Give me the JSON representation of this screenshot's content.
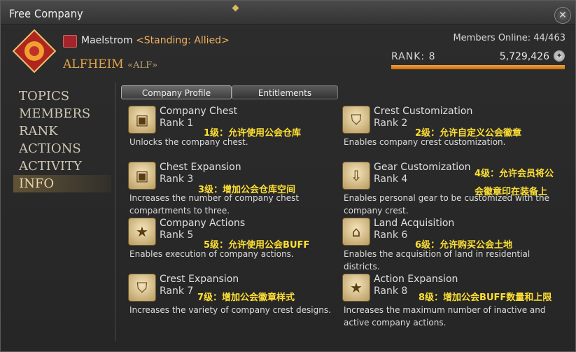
{
  "window": {
    "title": "Free Company",
    "close_glyph": "✕"
  },
  "header": {
    "grand_company": "Maelstrom",
    "standing": "<Standing: Allied>",
    "fc_name": "ALFHEIM",
    "fc_tag": "«ALF»",
    "members_online": "Members Online: 44/463",
    "rank_label": "RANK:",
    "rank_value": "8",
    "company_points": "5,729,426",
    "rank_progress": 1.0,
    "icons": {
      "crest": "fc-crest-icon",
      "gc": "maelstrom-icon",
      "points": "company-credits-icon"
    }
  },
  "sidebar": {
    "items": [
      {
        "label": "TOPICS"
      },
      {
        "label": "MEMBERS"
      },
      {
        "label": "RANK"
      },
      {
        "label": "ACTIONS"
      },
      {
        "label": "ACTIVITY"
      },
      {
        "label": "INFO",
        "active": true
      }
    ]
  },
  "tabs": [
    {
      "label": "Company Profile",
      "active": true
    },
    {
      "label": "Entitlements"
    }
  ],
  "entries": [
    {
      "name": "Company Chest",
      "rank": "Rank 1",
      "desc": "Unlocks the company chest.",
      "note": "1级：允许使用公会仓库",
      "icon": "chest-icon"
    },
    {
      "name": "Crest Customization",
      "rank": "Rank 2",
      "desc": "Enables company crest customization.",
      "note": "2级：允许自定义公会徽章",
      "icon": "shield-icon"
    },
    {
      "name": "Chest Expansion",
      "rank": "Rank 3",
      "desc": "Increases the number of company chest compartments to three.",
      "note": "3级：增加公会仓库空间",
      "icon": "chest-plus-icon"
    },
    {
      "name": "Gear Customization",
      "rank": "Rank 4",
      "desc": "Enables personal gear to be customized with the company crest.",
      "note": "4级：允许会员将公",
      "note2": "会徽章印在装备上",
      "icon": "gear-crest-icon"
    },
    {
      "name": "Company Actions",
      "rank": "Rank 5",
      "desc": "Enables execution of company actions.",
      "note": "5级：允许使用公会BUFF",
      "icon": "star-icon"
    },
    {
      "name": "Land Acquisition",
      "rank": "Rank 6",
      "desc": "Enables the acquisition of land in residential districts.",
      "note": "6级：允许购买公会土地",
      "icon": "house-icon"
    },
    {
      "name": "Crest Expansion",
      "rank": "Rank 7",
      "desc": "Increases the variety of company crest designs.",
      "note": "7级：增加公会徽章样式",
      "icon": "shield-plus-icon"
    },
    {
      "name": "Action Expansion",
      "rank": "Rank 8",
      "desc": "Increases the maximum number of inactive and active company actions.",
      "note": "8级：增加公会BUFF数量和上限",
      "icon": "star-plus-icon"
    }
  ],
  "colors": {
    "accent": "#e0a34a",
    "note": "#ffe033",
    "bar": "#f4a33a"
  }
}
